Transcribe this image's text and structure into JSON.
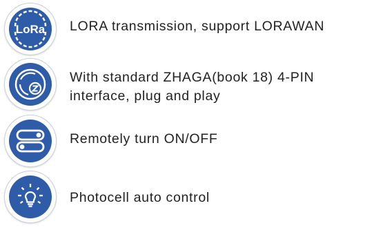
{
  "features": [
    {
      "icon": "lora-logo-icon",
      "text": "LORA transmission, support LORAWAN",
      "logo_text": "LoRa"
    },
    {
      "icon": "zhaga-connector-icon",
      "text_line1": "With standard ZHAGA(book 18) 4-PIN",
      "text_line2": "interface, plug and play"
    },
    {
      "icon": "on-off-switch-icon",
      "text": "Remotely turn ON/OFF"
    },
    {
      "icon": "photocell-bulb-icon",
      "text": "Photocell auto control"
    }
  ],
  "colors": {
    "icon_fill": "#2f5ca8",
    "icon_ring": "#c9cfd6",
    "text": "#222222",
    "background": "#ffffff"
  }
}
